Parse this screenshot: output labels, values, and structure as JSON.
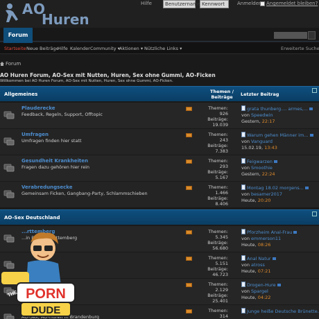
{
  "header": {
    "logo_ao": "AO",
    "logo_huren": "Huren",
    "help": "Hilfe",
    "username_placeholder": "Benutzername",
    "password_placeholder": "Kennwort",
    "login": "Anmelden",
    "remember": "Angemeldet bleiben?"
  },
  "nav": {
    "forum_tab": "Forum"
  },
  "subnav": {
    "items": [
      "Startseite",
      "Neue Beiträge",
      "Hilfe",
      "Kalender",
      "Community ▾",
      "Aktionen ▾",
      "Nützliche Links ▾"
    ],
    "extended_search": "Erweiterte Suche"
  },
  "breadcrumb": "Forum",
  "page": {
    "title": "AO Huren Forum, AO-Sex mit Nutten, Huren, Sex ohne Gummi, AO-Ficken",
    "subtitle": "Willkommen bei AO Huren Forum, AO-Sex mit Nutten, Huren, Sex ohne Gummi, AO-Ficken."
  },
  "sections": [
    {
      "title": "Allgemeines",
      "stats_header": "Themen / Beiträge",
      "last_header": "Letzter Beitrag",
      "forums": [
        {
          "name": "Plauderecke",
          "desc": "Feedback, Regeln, Support, Offtopic",
          "threads": "Themen: 926",
          "posts_label": "Beiträge:",
          "posts": "19.039",
          "last_title": "grata thunberg.... armes,...",
          "by": "von",
          "user": "Speedwin",
          "date": "Gestern,",
          "time": "22:17"
        },
        {
          "name": "Umfragen",
          "desc": "Umfragen finden hier statt",
          "threads": "Themen: 243",
          "posts_label": "Beiträge: 7.383",
          "posts": "",
          "last_title": "Warum gehen Männer im...",
          "by": "von",
          "user": "Vanguard",
          "date": "15.02.19,",
          "time": "13:43"
        },
        {
          "name": "Gesundheit Krankheiten",
          "desc": "Fragen dazu gehören hier rein",
          "threads": "Themen: 293",
          "posts_label": "Beiträge: 5.167",
          "posts": "",
          "last_title": "Feigwarzen",
          "by": "von",
          "user": "Smoothie",
          "date": "Gestern,",
          "time": "22:24"
        },
        {
          "name": "Verabredungsecke",
          "desc": "Gemeinsam Ficken, Gangbang-Party, Schlammschieben",
          "threads": "Themen: 1.466",
          "posts_label": "Beiträge: 8.406",
          "posts": "",
          "last_title": "Montag 18.02 morgens...",
          "by": "von",
          "user": "besamer2017",
          "date": "Heute,",
          "time": "20:20"
        }
      ]
    },
    {
      "title": "AO-Sex Deutschland",
      "forums": [
        {
          "name": "...rttemberg",
          "desc": "...in Baden Württemberg",
          "threads": "Themen: 5.345",
          "posts_label": "Beiträge:",
          "posts": "56.680",
          "last_title": "Pforzheim Anal-Frau",
          "by": "von",
          "user": "emmerson11",
          "date": "Heute,",
          "time": "08:26"
        },
        {
          "name": "",
          "desc": "",
          "threads": "Themen: 5.151",
          "posts_label": "Beiträge:",
          "posts": "46.723",
          "last_title": "Anal Natur",
          "by": "von",
          "user": "atross",
          "date": "Heute,",
          "time": "07:21"
        },
        {
          "name": "",
          "desc": "",
          "threads": "Themen: 2.129",
          "posts_label": "Beiträge:",
          "posts": "25.401",
          "last_title": "Drogen-Hure",
          "by": "von",
          "user": "Spargel",
          "date": "Heute,",
          "time": "04:22"
        },
        {
          "name": "",
          "desc": "AO-Sex, AO-Huren in Brandenburg",
          "threads": "Themen: 314",
          "posts_label": "",
          "posts": "",
          "last_title": "Junge heiße Deutsche Brünette...",
          "by": "",
          "user": "",
          "date": "",
          "time": ""
        }
      ]
    }
  ],
  "watermark": "THE PORN DUDE",
  "colors": {
    "section_bar": "#0e4e7e",
    "link": "#4d8ecf",
    "time": "#e08c2c",
    "active_nav": "#e04a3a"
  }
}
